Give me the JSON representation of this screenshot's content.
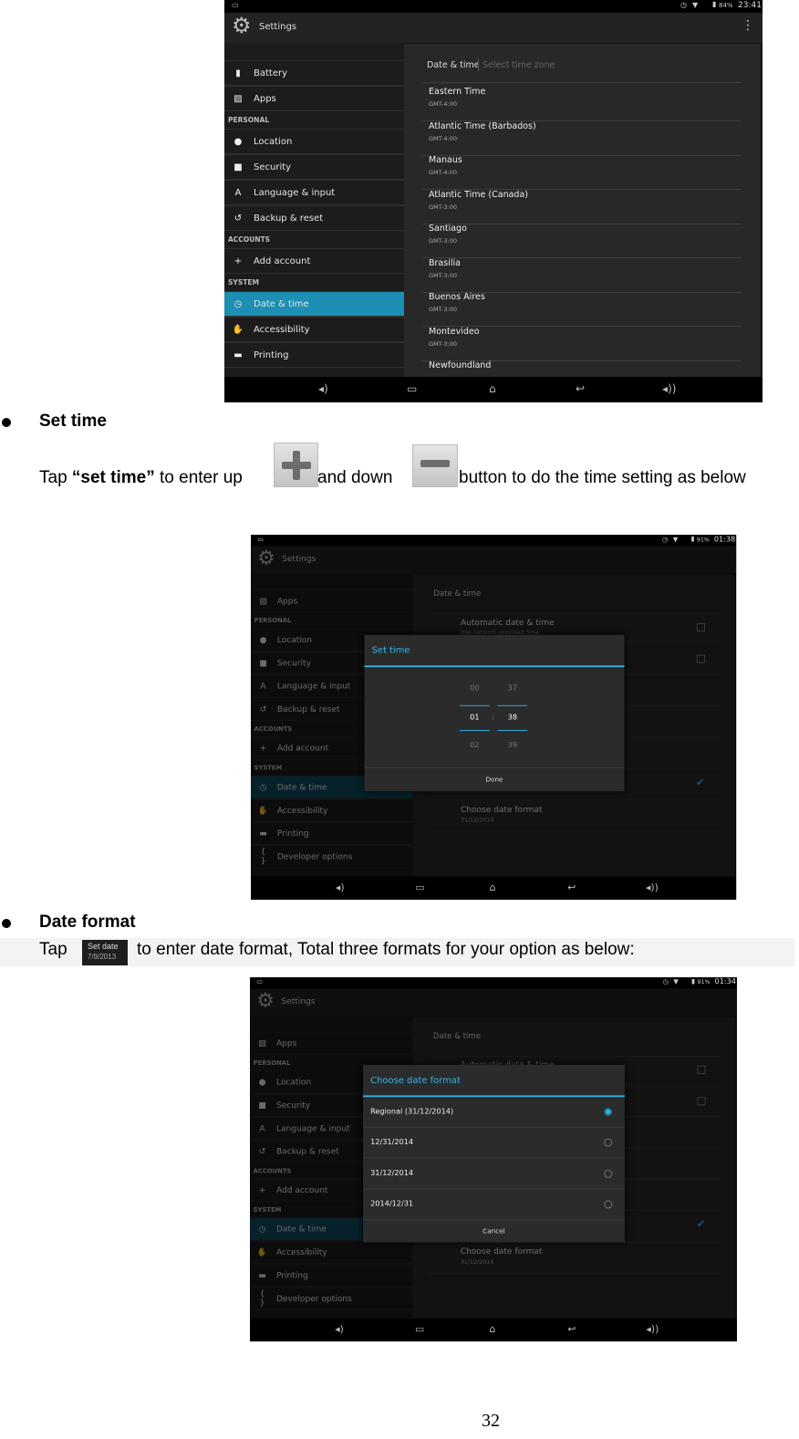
{
  "set_time_section": {
    "heading": "Set time",
    "text_before": "Tap ",
    "text_bold": "“set time”",
    "text_mid1": " to enter up",
    "text_mid2": " and down",
    "text_after": " button to do the time setting as below"
  },
  "date_format_section": {
    "heading": "Date format",
    "text_before": "Tap",
    "icon_title": "Set date",
    "icon_date": "7/9/2013",
    "text_after": "to enter date format, Total three formats for your option as below:"
  },
  "page_number": "32",
  "accent_color": "#33b5e5",
  "screens": [
    {
      "status": {
        "battery": "84%",
        "time": "23:41"
      },
      "title": "Settings",
      "sidebar": [
        {
          "type": "item",
          "label": "Battery",
          "icon": "battery-icon"
        },
        {
          "type": "item",
          "label": "Apps",
          "icon": "apps-icon"
        },
        {
          "type": "header",
          "label": "PERSONAL"
        },
        {
          "type": "item",
          "label": "Location",
          "icon": "location-icon"
        },
        {
          "type": "item",
          "label": "Security",
          "icon": "lock-icon"
        },
        {
          "type": "item",
          "label": "Language & input",
          "icon": "language-icon"
        },
        {
          "type": "item",
          "label": "Backup & reset",
          "icon": "backup-icon"
        },
        {
          "type": "header",
          "label": "ACCOUNTS"
        },
        {
          "type": "item",
          "label": "Add account",
          "icon": "plus-icon"
        },
        {
          "type": "header",
          "label": "SYSTEM"
        },
        {
          "type": "item",
          "label": "Date & time",
          "icon": "clock-icon",
          "selected": true
        },
        {
          "type": "item",
          "label": "Accessibility",
          "icon": "hand-icon"
        },
        {
          "type": "item",
          "label": "Printing",
          "icon": "printer-icon"
        }
      ],
      "panel": {
        "breadcrumb": "Date & time",
        "breadcrumb_sub": "Select time zone",
        "timezones": [
          {
            "name": "Eastern Time",
            "offset": "GMT-4:00"
          },
          {
            "name": "Atlantic Time (Barbados)",
            "offset": "GMT-4:00"
          },
          {
            "name": "Manaus",
            "offset": "GMT-4:00"
          },
          {
            "name": "Atlantic Time (Canada)",
            "offset": "GMT-3:00"
          },
          {
            "name": "Santiago",
            "offset": "GMT-3:00"
          },
          {
            "name": "Brasilia",
            "offset": "GMT-3:00"
          },
          {
            "name": "Buenos Aires",
            "offset": "GMT-3:00"
          },
          {
            "name": "Montevideo",
            "offset": "GMT-3:00"
          },
          {
            "name": "Newfoundland",
            "offset": ""
          }
        ]
      }
    },
    {
      "status": {
        "battery": "91%",
        "time": "01:38"
      },
      "title": "Settings",
      "sidebar": [
        {
          "type": "item",
          "label": "Apps",
          "icon": "apps-icon"
        },
        {
          "type": "header",
          "label": "PERSONAL"
        },
        {
          "type": "item",
          "label": "Location",
          "icon": "location-icon"
        },
        {
          "type": "item",
          "label": "Security",
          "icon": "lock-icon"
        },
        {
          "type": "item",
          "label": "Language & input",
          "icon": "language-icon"
        },
        {
          "type": "item",
          "label": "Backup & reset",
          "icon": "backup-icon"
        },
        {
          "type": "header",
          "label": "ACCOUNTS"
        },
        {
          "type": "item",
          "label": "Add account",
          "icon": "plus-icon"
        },
        {
          "type": "header",
          "label": "SYSTEM"
        },
        {
          "type": "item",
          "label": "Date & time",
          "icon": "clock-icon",
          "selected": true
        },
        {
          "type": "item",
          "label": "Accessibility",
          "icon": "hand-icon"
        },
        {
          "type": "item",
          "label": "Printing",
          "icon": "printer-icon"
        },
        {
          "type": "item",
          "label": "Developer options",
          "icon": "braces-icon"
        }
      ],
      "panel": {
        "breadcrumb": "Date & time",
        "auto_label": "Automatic date & time",
        "auto_sub": "Use network-provided time",
        "date_format_label": "Choose date format",
        "date_format_value": "31/12/2014"
      },
      "dialog": {
        "title": "Set time",
        "hours": [
          "00",
          "01",
          "02"
        ],
        "minutes": [
          "37",
          "38",
          "39"
        ],
        "separator": ":",
        "done": "Done"
      }
    },
    {
      "status": {
        "battery": "91%",
        "time": "01:34"
      },
      "title": "Settings",
      "sidebar": [
        {
          "type": "item",
          "label": "Apps",
          "icon": "apps-icon"
        },
        {
          "type": "header",
          "label": "PERSONAL"
        },
        {
          "type": "item",
          "label": "Location",
          "icon": "location-icon"
        },
        {
          "type": "item",
          "label": "Security",
          "icon": "lock-icon"
        },
        {
          "type": "item",
          "label": "Language & input",
          "icon": "language-icon"
        },
        {
          "type": "item",
          "label": "Backup & reset",
          "icon": "backup-icon"
        },
        {
          "type": "header",
          "label": "ACCOUNTS"
        },
        {
          "type": "item",
          "label": "Add account",
          "icon": "plus-icon"
        },
        {
          "type": "header",
          "label": "SYSTEM"
        },
        {
          "type": "item",
          "label": "Date & time",
          "icon": "clock-icon",
          "selected": true
        },
        {
          "type": "item",
          "label": "Accessibility",
          "icon": "hand-icon"
        },
        {
          "type": "item",
          "label": "Printing",
          "icon": "printer-icon"
        },
        {
          "type": "item",
          "label": "Developer options",
          "icon": "braces-icon"
        }
      ],
      "panel": {
        "breadcrumb": "Date & time",
        "auto_label": "Automatic date & time",
        "date_format_label": "Choose date format",
        "date_format_value": "31/12/2014"
      },
      "dialog": {
        "title": "Choose date format",
        "options": [
          {
            "label": "Regional (31/12/2014)",
            "selected": true
          },
          {
            "label": "12/31/2014",
            "selected": false
          },
          {
            "label": "31/12/2014",
            "selected": false
          },
          {
            "label": "2014/12/31",
            "selected": false
          }
        ],
        "cancel": "Cancel"
      }
    }
  ]
}
